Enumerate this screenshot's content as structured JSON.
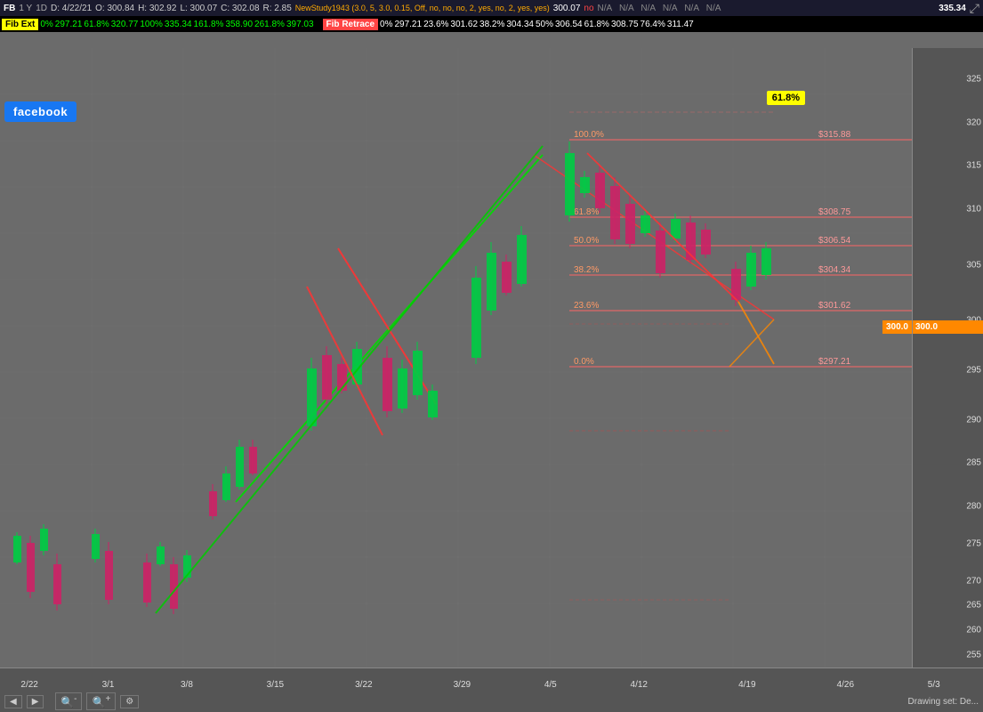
{
  "toolbar": {
    "symbol": "FB",
    "interval": "1 Y",
    "timeframe": "1D",
    "date": "D: 4/22/21",
    "open": "O: 300.84",
    "high": "H: 302.92",
    "low": "L: 300.07",
    "close": "C: 302.08",
    "change": "R: 2.85",
    "indicator_params": "NewStudy1943 (3.0, 5, 3.0, 0.15, Off, no, no, no, 2, yes, no, 2, yes, yes)",
    "indicator_val": "300.07",
    "no_val": "no",
    "na_vals": [
      "N/A",
      "N/A",
      "N/A",
      "N/A",
      "N/A",
      "N/A"
    ],
    "last_price": "335.34"
  },
  "fib_ext": {
    "label": "Fib Ext",
    "items": [
      {
        "pct": "0%",
        "val": "297.21"
      },
      {
        "pct": "61.8%",
        "val": "320.77"
      },
      {
        "pct": "100%",
        "val": "335.34"
      },
      {
        "pct": "161.8%",
        "val": "358.90"
      },
      {
        "pct": "261.8%",
        "val": "397.03"
      }
    ]
  },
  "fib_retrace": {
    "label": "Fib Retrace",
    "items": [
      {
        "pct": "0%",
        "val": "297.21"
      },
      {
        "pct": "23.6%",
        "val": "301.62"
      },
      {
        "pct": "38.2%",
        "val": "304.34"
      },
      {
        "pct": "50%",
        "val": "306.54"
      },
      {
        "pct": "61.8%",
        "val": "308.75"
      },
      {
        "pct": "76.4%",
        "val": "311.47"
      }
    ]
  },
  "fib_lines": [
    {
      "pct": "100.0%",
      "price": "$315.88",
      "y_pct": 15
    },
    {
      "pct": "61.8%",
      "price": "$308.75",
      "y_pct": 30
    },
    {
      "pct": "50.0%",
      "price": "$306.54",
      "y_pct": 37
    },
    {
      "pct": "38.2%",
      "price": "$304.34",
      "y_pct": 44
    },
    {
      "pct": "23.6%",
      "price": "$301.62",
      "y_pct": 53
    },
    {
      "pct": "0.0%",
      "price": "$297.21",
      "y_pct": 65
    }
  ],
  "price_scale": {
    "levels": [
      {
        "price": "325",
        "y_pct": 5
      },
      {
        "price": "320",
        "y_pct": 12
      },
      {
        "price": "315",
        "y_pct": 19
      },
      {
        "price": "310",
        "y_pct": 26
      },
      {
        "price": "305",
        "y_pct": 35
      },
      {
        "price": "300",
        "y_pct": 44
      },
      {
        "price": "295",
        "y_pct": 52
      },
      {
        "price": "290",
        "y_pct": 60
      },
      {
        "price": "285",
        "y_pct": 68
      },
      {
        "price": "280",
        "y_pct": 75
      },
      {
        "price": "275",
        "y_pct": 80
      },
      {
        "price": "270",
        "y_pct": 86
      },
      {
        "price": "265",
        "y_pct": 91
      },
      {
        "price": "260",
        "y_pct": 96
      }
    ]
  },
  "time_labels": [
    {
      "label": "2/22",
      "x_pct": 3
    },
    {
      "label": "3/1",
      "x_pct": 11
    },
    {
      "label": "3/8",
      "x_pct": 19
    },
    {
      "label": "3/15",
      "x_pct": 28
    },
    {
      "label": "3/22",
      "x_pct": 37
    },
    {
      "label": "3/29",
      "x_pct": 47
    },
    {
      "label": "4/5",
      "x_pct": 56
    },
    {
      "label": "4/12",
      "x_pct": 65
    },
    {
      "label": "4/19",
      "x_pct": 76
    },
    {
      "label": "4/26",
      "x_pct": 86
    },
    {
      "label": "5/3",
      "x_pct": 95
    }
  ],
  "badges": {
    "fib_61_8": "61.8%",
    "current_price": "300.0",
    "facebook": "facebook"
  },
  "bottom_toolbar": {
    "nav_left": "◀",
    "nav_right": "▶",
    "zoom_out": "🔍-",
    "zoom_in": "🔍+",
    "settings": "⚙",
    "drawing_set": "Drawing set: De..."
  },
  "colors": {
    "bull_candle": "#00cc44",
    "bear_candle": "#cc2266",
    "fib_line": "#ff6666",
    "trend_up": "#00cc00",
    "trend_down": "#ff3333",
    "background": "#6b6b6b",
    "price_badge": "#ff8800",
    "fib_badge_bg": "#ffff00",
    "fib_badge_text": "#000000"
  }
}
